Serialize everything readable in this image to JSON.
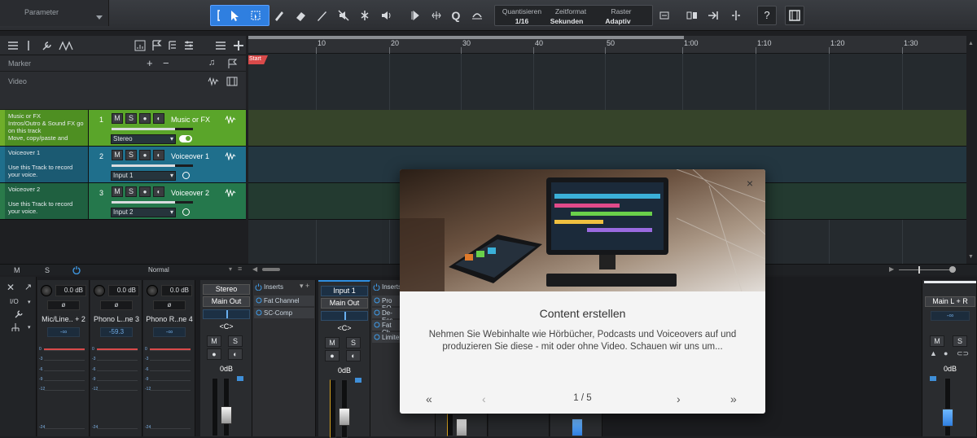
{
  "toolbar": {
    "parameter_label": "Parameter",
    "quantize_label": "Quantisieren",
    "quantize_value": "1/16",
    "timeformat_label": "Zeitformat",
    "timeformat_value": "Sekunden",
    "snap_label": "Raster",
    "snap_value": "Adaptiv",
    "help_label": "?"
  },
  "ruler": {
    "ticks": [
      "10",
      "20",
      "30",
      "40",
      "50",
      "1:00",
      "1:10",
      "1:20",
      "1:30"
    ]
  },
  "global_tracks": {
    "marker_label": "Marker",
    "marker_plus": "+",
    "marker_minus": "−",
    "video_label": "Video",
    "start_marker": "Start"
  },
  "tracks": [
    {
      "info": "Music or FX\nIntros/Outro & Sound FX go on this track\nMove, copy/paste and",
      "number": "1",
      "name": "Music or FX",
      "input": "Stereo",
      "color": "#6fae2a",
      "volume": 0.78
    },
    {
      "info": "Voiceover 1\n\nUse this Track to record your voice.",
      "number": "2",
      "name": "Voiceover 1",
      "input": "Input 1",
      "color": "#1f6f8c",
      "volume": 0.78
    },
    {
      "info": "Voiceover 2\n\nUse this Track to record your voice.",
      "number": "3",
      "name": "Voiceover 2",
      "input": "Input 2",
      "color": "#2a7a4a",
      "volume": 0.78
    }
  ],
  "track_buttons": {
    "mute": "M",
    "solo": "S"
  },
  "midbar": {
    "m": "M",
    "s": "S",
    "mode": "Normal"
  },
  "mixer": {
    "io_label": "I/O",
    "channels": [
      {
        "db": "0.0 dB",
        "phase": "ø",
        "name": "Mic/Line.. + 2",
        "pan": "-∞"
      },
      {
        "db": "0.0 dB",
        "phase": "ø",
        "name": "Phono L..ne 3",
        "pan": "-59.3"
      },
      {
        "db": "0.0 dB",
        "phase": "ø",
        "name": "Phono R..ne 4",
        "pan": "-∞"
      }
    ],
    "stereo_strip": {
      "title": "Stereo",
      "output": "Main Out",
      "pan": "<C>",
      "gain": "0dB"
    },
    "input1_strip": {
      "title": "Input 1",
      "output": "Main Out",
      "pan": "<C>",
      "gain": "0dB"
    },
    "inserts_label": "Inserts",
    "inserts_stereo": [
      "Fat Channel",
      "SC-Comp"
    ],
    "inserts_input1": [
      "Pro EQ",
      "De-Ess",
      "Fat Ch",
      "Limiter"
    ],
    "main_strip": {
      "title": "Main L + R",
      "pan": "-∞",
      "gain": "0dB"
    },
    "scale_labels": [
      "0",
      "-3",
      "-6",
      "-9",
      "-12",
      "-24"
    ]
  },
  "modal": {
    "title": "Content erstellen",
    "body": "Nehmen Sie Webinhalte wie Hörbücher, Podcasts und Voiceovers auf und produzieren Sie diese - mit oder ohne Video. Schauen wir uns um...",
    "pager": "1 / 5",
    "close": "×",
    "first": "«",
    "prev": "‹",
    "next": "›",
    "last": "»"
  }
}
